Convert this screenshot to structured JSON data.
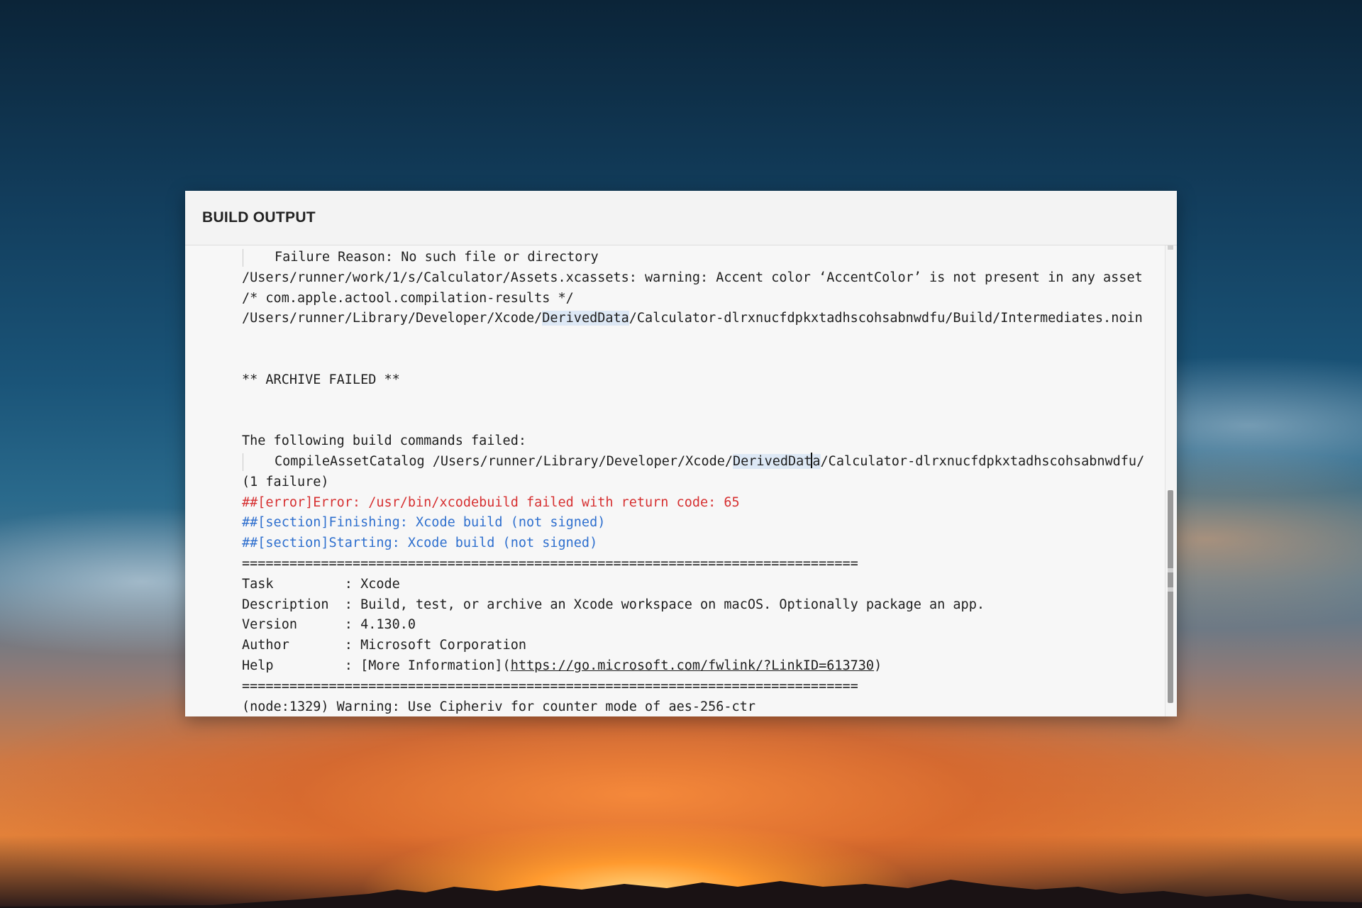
{
  "panel": {
    "title": "BUILD OUTPUT"
  },
  "log": {
    "l1": "Failure Reason: No such file or directory",
    "l2": "/Users/runner/work/1/s/Calculator/Assets.xcassets: warning: Accent color ‘AccentColor’ is not present in any asset",
    "l3": "/* com.apple.actool.compilation-results */",
    "l4_pre": "/Users/runner/Library/Developer/Xcode/",
    "l4_hl": "DerivedData",
    "l4_post": "/Calculator-dlrxnucfdpkxtadhscohsabnwdfu/Build/Intermediates.noin",
    "l5": "** ARCHIVE FAILED **",
    "l6": "The following build commands failed:",
    "l7_pre": "CompileAssetCatalog /Users/runner/Library/Developer/Xcode/",
    "l7_hl_a": "DerivedDat",
    "l7_hl_b": "a",
    "l7_post": "/Calculator-dlrxnucfdpkxtadhscohsabnwdfu/",
    "l8": "(1 failure)",
    "l9": "##[error]Error: /usr/bin/xcodebuild failed with return code: 65",
    "l10": "##[section]Finishing: Xcode build (not signed)",
    "l11": "##[section]Starting: Xcode build (not signed)",
    "sep": "==============================================================================",
    "task": "Task         : Xcode",
    "description": "Description  : Build, test, or archive an Xcode workspace on macOS. Optionally package an app.",
    "version": "Version      : 4.130.0",
    "author": "Author       : Microsoft Corporation",
    "help_pre": "Help         : [More Information](",
    "help_link": "https://go.microsoft.com/fwlink/?LinkID=613730",
    "help_post": ")",
    "l_last": "(node:1329) Warning: Use Cipheriv for counter mode of aes-256-ctr"
  },
  "colors": {
    "error": "#d63031",
    "section": "#2e6fce",
    "highlight": "#dde8f5"
  }
}
